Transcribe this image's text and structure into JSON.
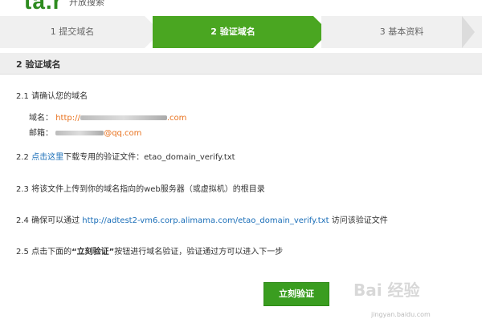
{
  "logo": {
    "text": "ta.r",
    "subtitle": "开放搜索"
  },
  "steps": [
    {
      "label": "1 提交域名",
      "state": "done"
    },
    {
      "label": "2 验证域名",
      "state": "active"
    },
    {
      "label": "3 基本资料",
      "state": "next"
    }
  ],
  "section": {
    "title": "2 验证域名"
  },
  "items": {
    "s1": "2.1 请确认您的域名",
    "domain_label": "域名：",
    "domain_value_prefix": "http://",
    "domain_value_suffix": ".com",
    "email_label": "邮箱：",
    "email_value_suffix": "@qq.com",
    "s2_prefix": "2.2 ",
    "s2_link": "点击这里",
    "s2_suffix": "下载专用的验证文件：etao_domain_verify.txt",
    "s3": "2.3 将该文件上传到你的域名指向的web服务器（或虚拟机）的根目录",
    "s4_prefix": "2.4 确保可以通过 ",
    "s4_link": "http://adtest2-vm6.corp.alimama.com/etao_domain_verify.txt",
    "s4_suffix": " 访问该验证文件",
    "s5_prefix": "2.5 点击下面的",
    "s5_bold": "“立刻验证”",
    "s5_suffix": "按钮进行域名验证，验证通过方可以进入下一步"
  },
  "button": {
    "label": "立刻验证"
  },
  "watermark": {
    "text": "Bai 经验",
    "sub": "jingyan.baidu.com"
  },
  "colors": {
    "accent": "#4aa621",
    "button": "#3a9d20",
    "link": "#1a6eb8",
    "highlight": "#e8711d"
  }
}
